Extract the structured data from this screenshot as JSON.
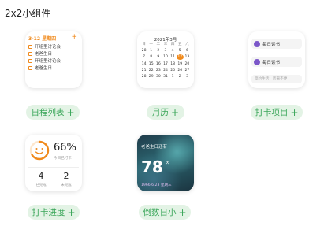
{
  "page_title": "2x2小组件",
  "widgets": [
    {
      "pill_label": "日程列表",
      "header": "3-12 星期四",
      "add_glyph": "+",
      "tasks": [
        "开组里讨论会",
        "老爸生日",
        "开组里讨论会",
        "老爸生日"
      ]
    },
    {
      "pill_label": "月历",
      "title": "2021年3月",
      "weekdays": [
        "日",
        "一",
        "二",
        "三",
        "四",
        "五",
        "六"
      ],
      "days": [
        [
          "28",
          "1",
          "2",
          "3",
          "4",
          "5",
          "6"
        ],
        [
          "7",
          "8",
          "9",
          "10",
          "11",
          "12",
          "13"
        ],
        [
          "14",
          "15",
          "16",
          "17",
          "18",
          "19",
          "20"
        ],
        [
          "21",
          "22",
          "23",
          "24",
          "25",
          "26",
          "27"
        ],
        [
          "28",
          "29",
          "30",
          "31",
          "1",
          "2",
          "3"
        ]
      ],
      "today": "12"
    },
    {
      "pill_label": "打卡项目",
      "items": [
        "每日读书",
        "每日读书"
      ],
      "quote": "简约生活，历来不便"
    },
    {
      "pill_label": "打卡进度",
      "percent": "66%",
      "percent_sub": "今日已打卡",
      "stats": [
        {
          "num": "4",
          "label": "已完成"
        },
        {
          "num": "2",
          "label": "未完成"
        }
      ],
      "progress": 0.66
    },
    {
      "pill_label": "倒数日小",
      "event": "老爸生日还有",
      "days": "78",
      "unit": "天",
      "date": "1966.6.23 星期三"
    }
  ],
  "pill_plus": "+",
  "colors": {
    "accent_orange": "#f08a1c",
    "pill_bg": "#e3f3e5",
    "pill_text": "#3aa659"
  }
}
